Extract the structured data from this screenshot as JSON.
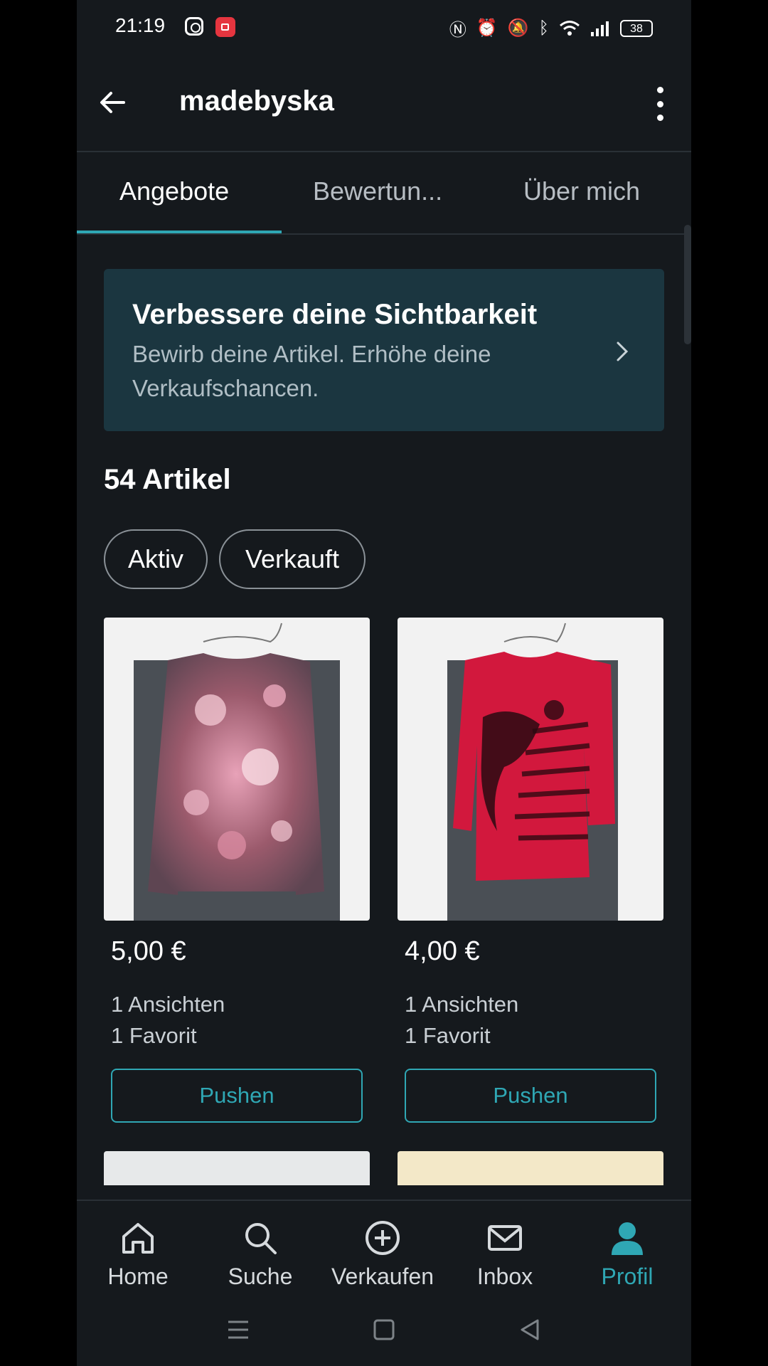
{
  "status_bar": {
    "time": "21:19",
    "battery": "38"
  },
  "header": {
    "title": "madebyska"
  },
  "tabs": [
    {
      "label": "Angebote",
      "active": true
    },
    {
      "label": "Bewertun...",
      "active": false
    },
    {
      "label": "Über mich",
      "active": false
    }
  ],
  "banner": {
    "title": "Verbessere deine Sichtbarkeit",
    "subtitle": "Bewirb deine Artikel. Erhöhe deine Verkaufschancen."
  },
  "items_count": "54 Artikel",
  "filters": [
    {
      "label": "Aktiv"
    },
    {
      "label": "Verkauft"
    }
  ],
  "items": [
    {
      "price": "5,00 €",
      "views": "1 Ansichten",
      "favorites": "1 Favorit",
      "action": "Pushen",
      "image_desc": "floral-long-sleeve-shirt"
    },
    {
      "price": "4,00 €",
      "views": "1 Ansichten",
      "favorites": "1 Favorit",
      "action": "Pushen",
      "image_desc": "red-long-sleeve-shirt"
    }
  ],
  "bottom_nav": [
    {
      "label": "Home",
      "icon": "home-icon",
      "active": false
    },
    {
      "label": "Suche",
      "icon": "search-icon",
      "active": false
    },
    {
      "label": "Verkaufen",
      "icon": "plus-circle-icon",
      "active": false
    },
    {
      "label": "Inbox",
      "icon": "mail-icon",
      "active": false
    },
    {
      "label": "Profil",
      "icon": "profile-icon",
      "active": true
    }
  ],
  "colors": {
    "accent": "#2fa7b4",
    "background": "#15191d",
    "banner": "#1b3640"
  }
}
